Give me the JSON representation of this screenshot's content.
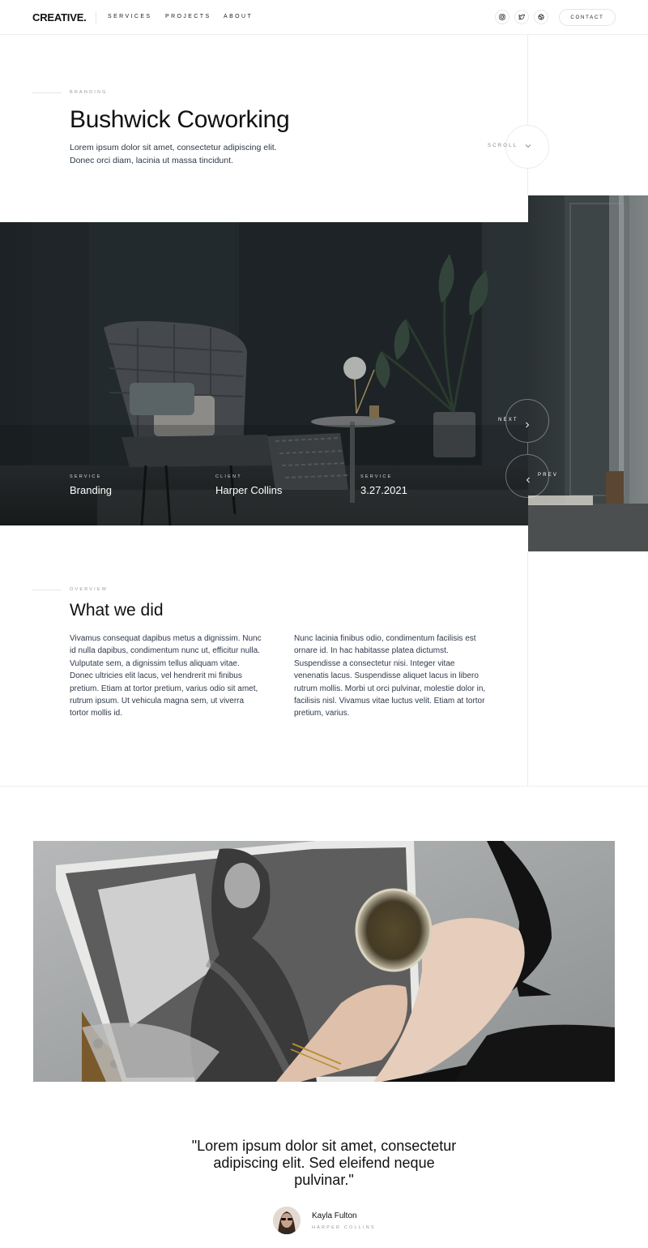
{
  "header": {
    "logo": "CREATIVE.",
    "nav": [
      "SERVICES",
      "PROJECTS",
      "ABOUT"
    ],
    "social_icons": [
      "instagram-icon",
      "twitter-icon",
      "dribbble-icon"
    ],
    "contact_label": "CONTACT"
  },
  "hero": {
    "eyebrow": "BRANDING",
    "title": "Bushwick Coworking",
    "description": "Lorem ipsum dolor sit amet, consectetur adipiscing elit. Donec orci diam, lacinia ut massa tincidunt.",
    "scroll_label": "SCROLL"
  },
  "project_meta": [
    {
      "label": "SERVICE",
      "value": "Branding"
    },
    {
      "label": "CLIENT",
      "value": "Harper Collins"
    },
    {
      "label": "SERVICE",
      "value": "3.27.2021"
    }
  ],
  "pager": {
    "next_label": "NEXT",
    "prev_label": "PREV"
  },
  "overview": {
    "eyebrow": "OVERVIEW",
    "title": "What we did",
    "col1": "Vivamus consequat dapibus metus a dignissim. Nunc id nulla dapibus, condimentum nunc ut, efficitur nulla. Vulputate sem, a dignissim tellus aliquam vitae. Donec ultricies elit lacus, vel hendrerit mi finibus pretium. Etiam at tortor pretium, varius odio sit amet, rutrum ipsum. Ut vehicula magna sem, ut viverra tortor mollis id.",
    "col2": "Nunc lacinia finibus odio, condimentum facilisis est ornare id. In hac habitasse platea dictumst. Suspendisse a consectetur nisi. Integer vitae venenatis lacus. Suspendisse aliquet lacus in libero rutrum mollis. Morbi ut orci pulvinar, molestie dolor in, facilisis nisl. Vivamus vitae luctus velit. Etiam at tortor pretium, varius."
  },
  "testimonial": {
    "quote": "\"Lorem ipsum dolor sit amet, consectetur adipiscing elit. Sed eleifend neque pulvinar.\"",
    "author_name": "Kayla Fulton",
    "author_role": "HARPER COLLINS"
  },
  "colors": {
    "text": "#111111",
    "body_text": "#2f3a4a",
    "muted": "#9a9a9a",
    "border": "#ececec"
  }
}
